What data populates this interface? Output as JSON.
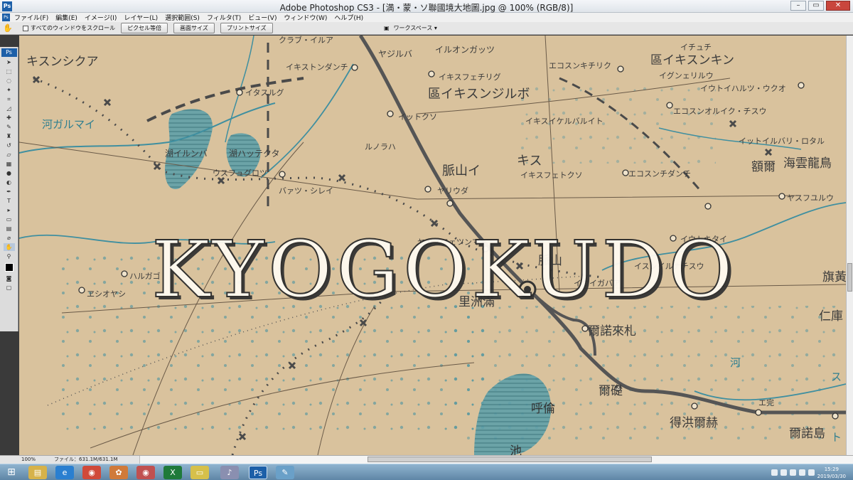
{
  "window": {
    "title": "Adobe Photoshop CS3 - [満・蒙・ソ聯國境大地圖.jpg @ 100% (RGB/8)]",
    "app_badge": "Ps",
    "controls": {
      "minimize": "–",
      "restore": "▭",
      "close": "✕"
    }
  },
  "menu": {
    "items": [
      "ファイル(F)",
      "編集(E)",
      "イメージ(I)",
      "レイヤー(L)",
      "選択範囲(S)",
      "フィルタ(T)",
      "ビュー(V)",
      "ウィンドウ(W)",
      "ヘルプ(H)"
    ]
  },
  "options": {
    "scroll_all_windows": "すべてのウィンドウをスクロール",
    "actual_pixels": "ピクセル等倍",
    "fit_screen": "画面サイズ",
    "print_size": "プリントサイズ",
    "workspace": "ワークスペース ▾"
  },
  "canvas": {
    "watermark": "KYOGOKUDO",
    "labels": [
      "ヤジルバ",
      "イルオンガッツ",
      "クラブ・イルア",
      "イキストンダンチ",
      "キスンシクア",
      "イタスルグ",
      "河ガルマイ",
      "湖イルンバ",
      "湖ハッテクタ",
      "イキスフェチリグ",
      "區イキスンジルボ",
      "イットクソ",
      "ルノラハ",
      "ウスフュグロツ",
      "バァツ・シレイ",
      "ヤリウダ",
      "イキスフェトクソ",
      "エコスンチダンチ",
      "脈山イ",
      "キス",
      "イキスイケルバルイト",
      "エコスンキチリク",
      "イチュチ",
      "區イキスンキン",
      "イグンェリルウ",
      "イウトイハルツ・ウクオ",
      "エコスンオルイク・チスウ",
      "イットイルバリ・ロタル",
      "海雲龍鳥",
      "額爾",
      "ヤスフユルウ",
      "イウトキタイ",
      "ヤカスフェツンマ",
      "脈山",
      "イスンイルナチスウ",
      "イウイガバア",
      "里洲滿",
      "ハルガゴ",
      "ヱシオヤシ",
      "爾諾來札",
      "爾礎",
      "得洪爾赫",
      "爾諾島",
      "呼倫",
      "池",
      "旗黃",
      "仁庫",
      "河",
      "エ完",
      "ス",
      "ト"
    ]
  },
  "status": {
    "zoom": "100%",
    "file_info": "ファイル：631.1M/631.1M"
  },
  "taskbar": {
    "icons": [
      "explorer-icon",
      "ie-icon",
      "chrome-icon",
      "photos-icon",
      "excel-icon",
      "folder-icon",
      "itunes-icon",
      "photoshop-icon",
      "paint-icon"
    ],
    "icon_glyphs": [
      "▤",
      "e",
      "◉",
      "✿",
      "X",
      "▭",
      "♪",
      "Ps",
      "✎"
    ],
    "time": "15:29",
    "date": "2019/03/30"
  },
  "colors": {
    "paper": "#dcc7a3",
    "river": "#3f8fa0",
    "ink": "#4a4a4a",
    "rail": "#5a5a5a",
    "photoshop_blue": "#1c5fa8"
  }
}
